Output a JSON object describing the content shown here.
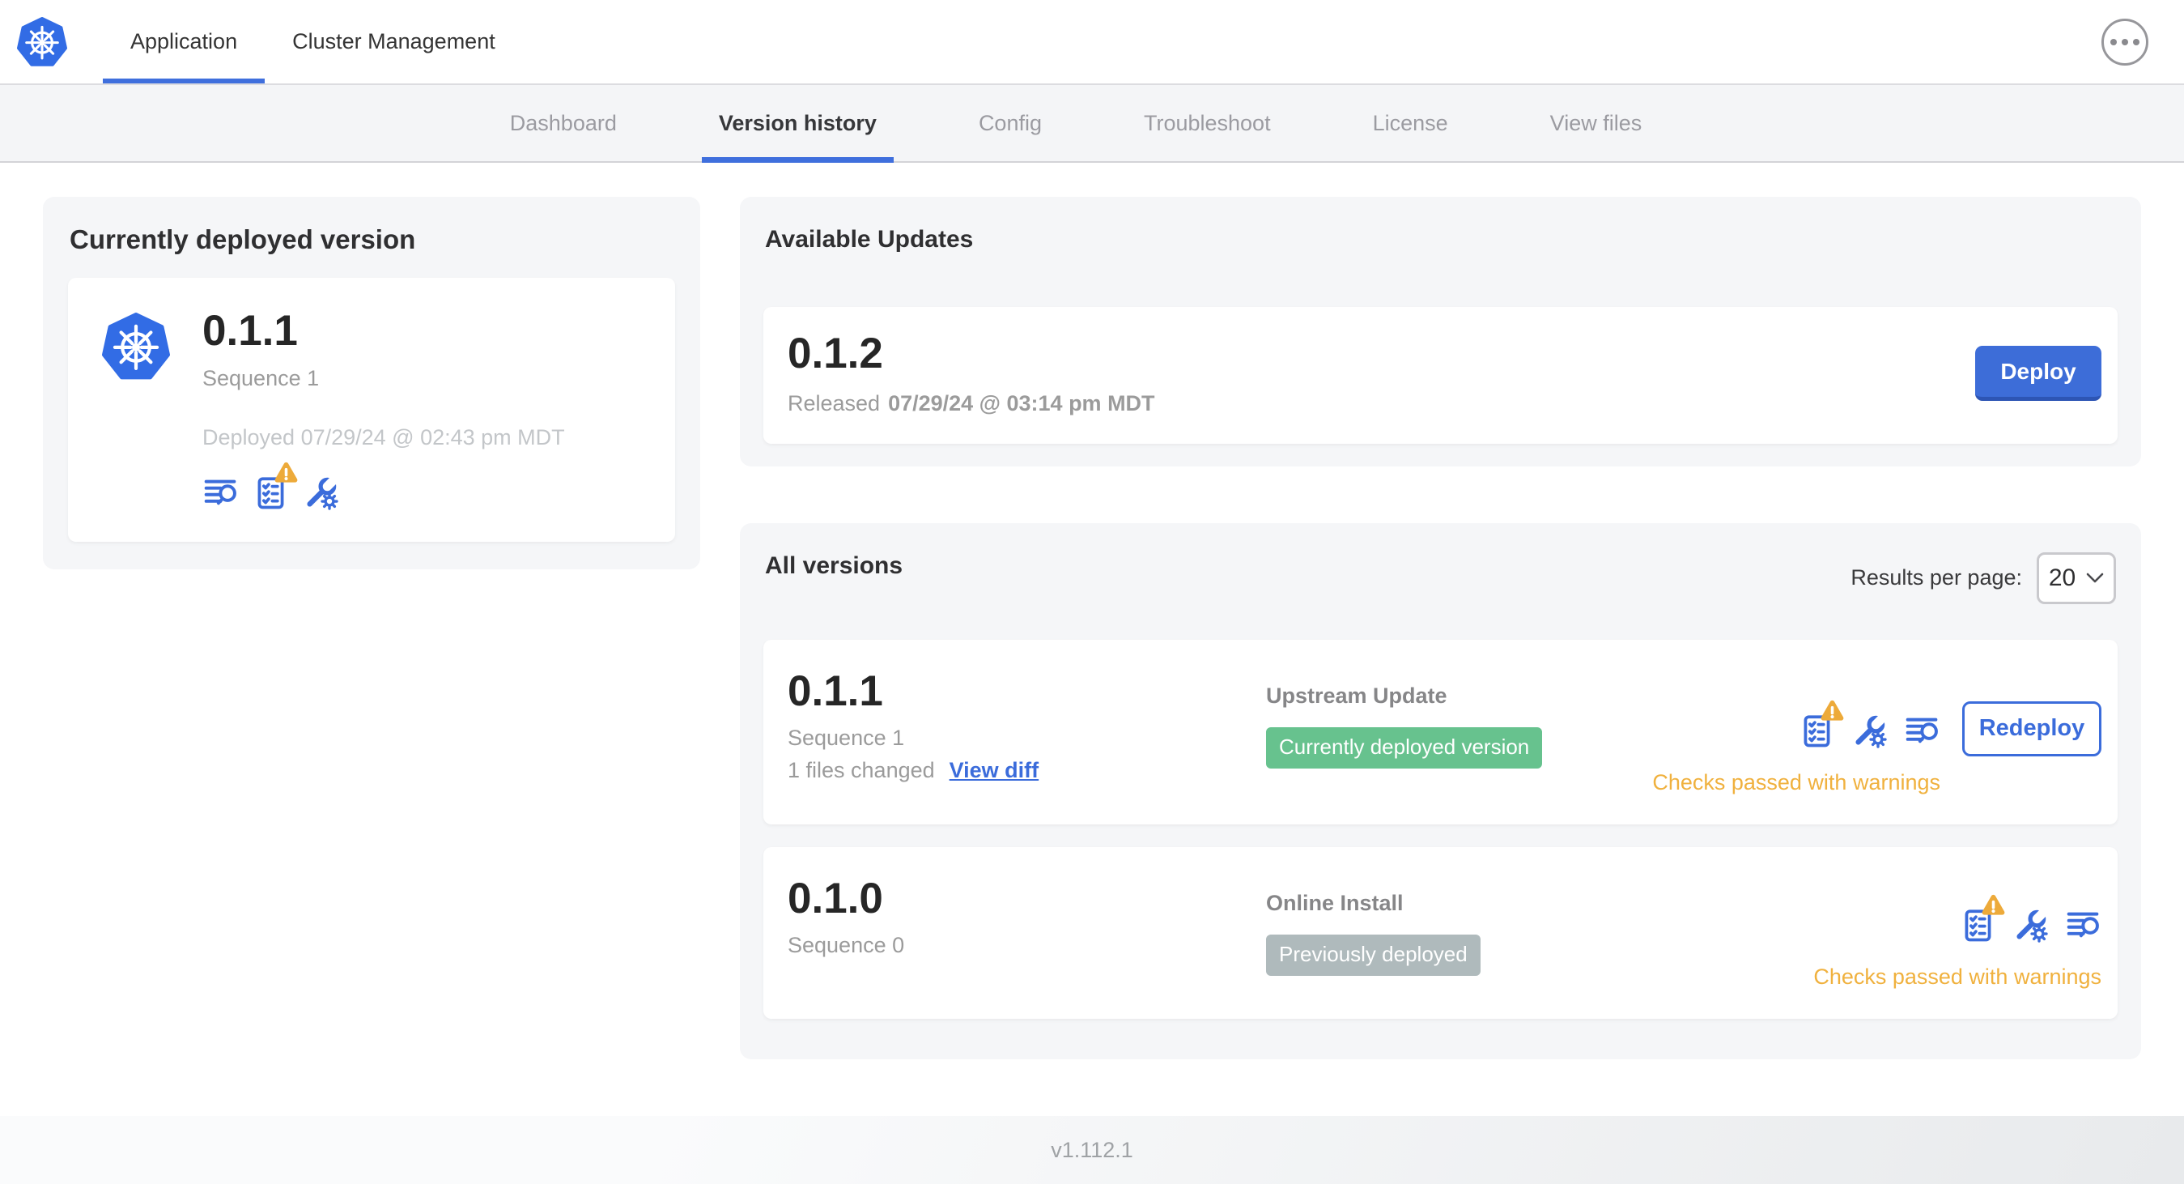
{
  "header": {
    "logo": "kubernetes-logo",
    "tabs": [
      {
        "label": "Application",
        "active": true
      },
      {
        "label": "Cluster Management",
        "active": false
      }
    ],
    "menu_icon": "ellipsis-menu"
  },
  "subnav": {
    "tabs": [
      {
        "label": "Dashboard",
        "active": false
      },
      {
        "label": "Version history",
        "active": true
      },
      {
        "label": "Config",
        "active": false
      },
      {
        "label": "Troubleshoot",
        "active": false
      },
      {
        "label": "License",
        "active": false
      },
      {
        "label": "View files",
        "active": false
      }
    ]
  },
  "currently_deployed": {
    "title": "Currently deployed version",
    "version": "0.1.1",
    "sequence": "Sequence 1",
    "deployed": "Deployed 07/29/24 @ 02:43 pm MDT",
    "icons": [
      "release-notes-icon",
      "preflight-checks-warning-icon",
      "config-values-icon"
    ]
  },
  "available_updates": {
    "title": "Available Updates",
    "version": "0.1.2",
    "released_prefix": "Released",
    "released_date": "07/29/24 @ 03:14 pm MDT",
    "deploy_label": "Deploy"
  },
  "all_versions": {
    "title": "All versions",
    "results_per_page_label": "Results per page:",
    "results_per_page_value": "20",
    "rows": [
      {
        "version": "0.1.1",
        "sequence": "Sequence 1",
        "files_changed": "1 files changed",
        "view_diff_label": "View diff",
        "source": "Upstream Update",
        "badge_label": "Currently deployed version",
        "badge_color": "#67c28e",
        "status": "Checks passed with warnings",
        "action_label": "Redeploy",
        "icons": [
          "preflight-checks-warning-icon",
          "config-values-icon",
          "release-notes-icon"
        ]
      },
      {
        "version": "0.1.0",
        "sequence": "Sequence 0",
        "source": "Online Install",
        "badge_label": "Previously deployed",
        "badge_color": "#afbabc",
        "status": "Checks passed with warnings",
        "icons": [
          "preflight-checks-warning-icon",
          "config-values-icon",
          "release-notes-icon"
        ]
      }
    ]
  },
  "footer": {
    "app_version": "v1.112.1"
  },
  "colors": {
    "primary_blue": "#3b6cdb",
    "kubernetes_blue": "#326ce5",
    "success_green": "#67c28e",
    "muted_badge_gray": "#afbabc",
    "warning_amber": "#f0b13e",
    "active_tab_underline": "#3f6fdd",
    "card_gray": "#f5f6f8"
  }
}
